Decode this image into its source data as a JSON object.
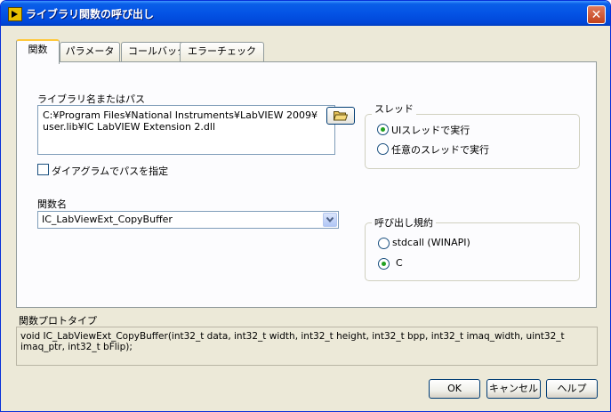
{
  "window": {
    "title": "ライブラリ関数の呼び出し",
    "close_glyph": "✕"
  },
  "tabs": [
    {
      "label": "関数",
      "active": true
    },
    {
      "label": "パラメータ",
      "active": false
    },
    {
      "label": "コールバック",
      "active": false
    },
    {
      "label": "エラーチェック",
      "active": false
    }
  ],
  "library": {
    "label": "ライブラリ名またはパス",
    "path": "C:¥Program Files¥National Instruments¥LabVIEW 2009¥\nuser.lib¥IC LabVIEW Extension 2.dll",
    "diagram_path_checkbox": {
      "label": "ダイアグラムでパスを指定",
      "checked": false
    }
  },
  "function": {
    "label": "関数名",
    "selected": "IC_LabViewExt_CopyBuffer"
  },
  "thread": {
    "label": "スレッド",
    "options": [
      {
        "label": "UIスレッドで実行",
        "selected": true
      },
      {
        "label": "任意のスレッドで実行",
        "selected": false
      }
    ]
  },
  "calling_convention": {
    "label": "呼び出し規約",
    "options": [
      {
        "label": "stdcall (WINAPI)",
        "selected": false
      },
      {
        "label": "C",
        "selected": true
      }
    ]
  },
  "prototype": {
    "label": "関数プロトタイプ",
    "text": "void  IC_LabViewExt_CopyBuffer(int32_t data, int32_t width, int32_t height, int32_t bpp, int32_t imaq_width, uint32_t imaq_ptr, int32_t bFlip);"
  },
  "buttons": {
    "ok": "OK",
    "cancel": "キャンセル",
    "help": "ヘルプ"
  },
  "colors": {
    "title_bar": "#0453e5",
    "dialog_bg": "#ece9d8",
    "panel_bg": "#fcfcfe",
    "radio_dot": "#21a121"
  }
}
